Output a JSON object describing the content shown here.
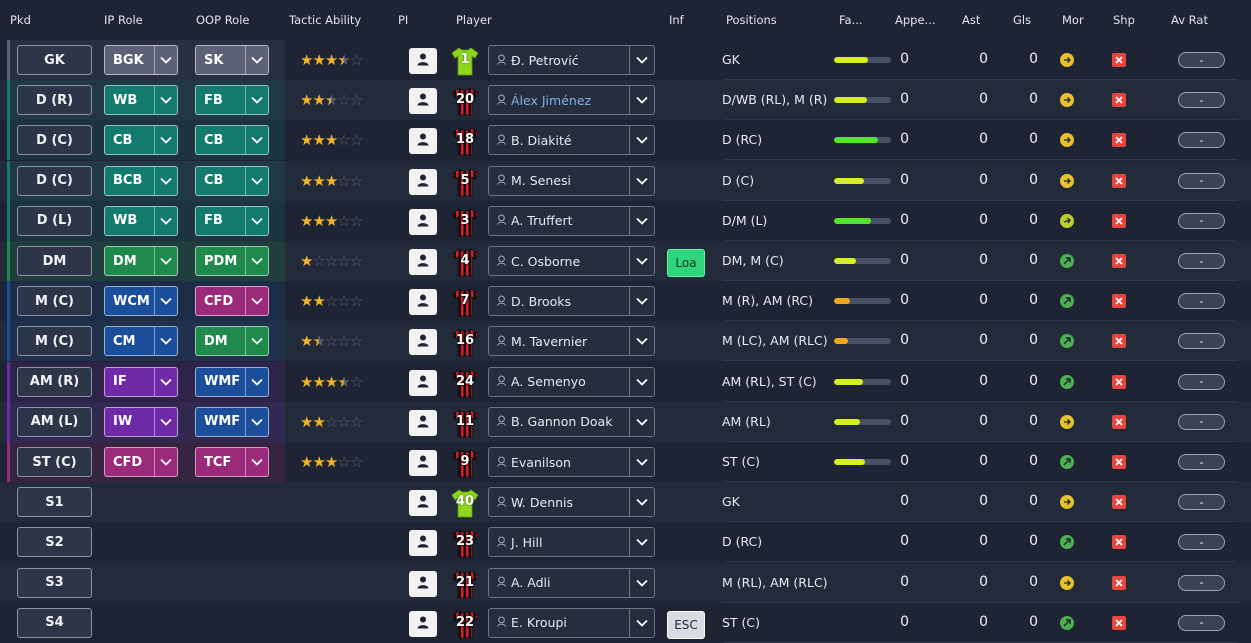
{
  "columns": {
    "pkd": "Pkd",
    "ip_role": "IP Role",
    "oop_role": "OOP Role",
    "tactic_ability": "Tactic Ability",
    "pi": "PI",
    "player": "Player",
    "inf": "Inf",
    "positions": "Positions",
    "fa": "Fa...",
    "appe": "Appe...",
    "ast": "Ast",
    "gls": "Gls",
    "mor": "Mor",
    "shp": "Shp",
    "av_rat": "Av Rat"
  },
  "colors": {
    "gk": "#5c6178",
    "defence": "#137a6e",
    "midfield_dm": "#1f8a4c",
    "midfield": "#1b4f9c",
    "attack": "#6f2aa8",
    "forward": "#9c2a7a",
    "fit_green": "#52e62a",
    "fit_yellow": "#d7ef1e",
    "fit_orange": "#f2a71a",
    "shp_red": "#e8453c"
  },
  "rows": [
    {
      "pkd": "GK",
      "ip": "BGK",
      "ip_c": "gk",
      "oop": "SK",
      "oop_c": "gk",
      "stars": 3.5,
      "shirt": "1",
      "gk": true,
      "name": "Đ. Petrović",
      "link": false,
      "inf": "",
      "pos": "GK",
      "fit": 0.6,
      "fitc": "fit_yellow",
      "appe": "0",
      "ast": "0",
      "gls": "0",
      "mor": "y",
      "avr": "-"
    },
    {
      "pkd": "D (R)",
      "ip": "WB",
      "ip_c": "defence",
      "oop": "FB",
      "oop_c": "defence",
      "stars": 2.5,
      "shirt": "20",
      "gk": false,
      "name": "Álex Jiménez",
      "link": true,
      "inf": "",
      "pos": "D/WB (RL), M (R)",
      "fit": 0.58,
      "fitc": "fit_yellow",
      "appe": "0",
      "ast": "0",
      "gls": "0",
      "mor": "y",
      "avr": "-"
    },
    {
      "pkd": "D (C)",
      "ip": "CB",
      "ip_c": "defence",
      "oop": "CB",
      "oop_c": "defence",
      "stars": 3,
      "shirt": "18",
      "gk": false,
      "name": "B. Diakité",
      "link": false,
      "inf": "",
      "pos": "D (RC)",
      "fit": 0.77,
      "fitc": "fit_green",
      "appe": "0",
      "ast": "0",
      "gls": "0",
      "mor": "y",
      "avr": "-"
    },
    {
      "pkd": "D (C)",
      "ip": "BCB",
      "ip_c": "defence",
      "oop": "CB",
      "oop_c": "defence",
      "stars": 3,
      "shirt": "5",
      "gk": false,
      "name": "M. Senesi",
      "link": false,
      "inf": "",
      "pos": "D (C)",
      "fit": 0.53,
      "fitc": "fit_yellow",
      "appe": "0",
      "ast": "0",
      "gls": "0",
      "mor": "y",
      "avr": "-"
    },
    {
      "pkd": "D (L)",
      "ip": "WB",
      "ip_c": "defence",
      "oop": "FB",
      "oop_c": "defence",
      "stars": 3,
      "shirt": "3",
      "gk": false,
      "name": "A. Truffert",
      "link": false,
      "inf": "",
      "pos": "D/M (L)",
      "fit": 0.65,
      "fitc": "fit_green",
      "appe": "0",
      "ast": "0",
      "gls": "0",
      "mor": "yg",
      "avr": "-"
    },
    {
      "pkd": "DM",
      "ip": "DM",
      "ip_c": "midfield_dm",
      "oop": "PDM",
      "oop_c": "midfield_dm",
      "stars": 1,
      "shirt": "4",
      "gk": false,
      "name": "C. Osborne",
      "link": false,
      "inf": "Loa",
      "inf_c": "loa",
      "pos": "DM, M (C)",
      "fit": 0.38,
      "fitc": "fit_yellow",
      "appe": "0",
      "ast": "0",
      "gls": "0",
      "mor": "g",
      "avr": "-"
    },
    {
      "pkd": "M (C)",
      "ip": "WCM",
      "ip_c": "midfield",
      "oop": "CFD",
      "oop_c": "forward",
      "stars": 2,
      "shirt": "7",
      "gk": false,
      "name": "D. Brooks",
      "link": false,
      "inf": "",
      "pos": "M (R), AM (RC)",
      "fit": 0.28,
      "fitc": "fit_orange",
      "appe": "0",
      "ast": "0",
      "gls": "0",
      "mor": "g",
      "avr": "-"
    },
    {
      "pkd": "M (C)",
      "ip": "CM",
      "ip_c": "midfield",
      "oop": "DM",
      "oop_c": "midfield_dm",
      "stars": 1.5,
      "shirt": "16",
      "gk": false,
      "name": "M. Tavernier",
      "link": false,
      "inf": "",
      "pos": "M (LC), AM (RLC)",
      "fit": 0.24,
      "fitc": "fit_orange",
      "appe": "0",
      "ast": "0",
      "gls": "0",
      "mor": "g",
      "avr": "-"
    },
    {
      "pkd": "AM (R)",
      "ip": "IF",
      "ip_c": "attack",
      "oop": "WMF",
      "oop_c": "midfield",
      "stars": 3.5,
      "shirt": "24",
      "gk": false,
      "name": "A. Semenyo",
      "link": false,
      "inf": "",
      "pos": "AM (RL), ST (C)",
      "fit": 0.5,
      "fitc": "fit_yellow",
      "appe": "0",
      "ast": "0",
      "gls": "0",
      "mor": "g",
      "avr": "-"
    },
    {
      "pkd": "AM (L)",
      "ip": "IW",
      "ip_c": "attack",
      "oop": "WMF",
      "oop_c": "midfield",
      "stars": 2,
      "shirt": "11",
      "gk": false,
      "name": "B. Gannon Doak",
      "link": false,
      "inf": "",
      "pos": "AM (RL)",
      "fit": 0.46,
      "fitc": "fit_yellow",
      "appe": "0",
      "ast": "0",
      "gls": "0",
      "mor": "y",
      "avr": "-"
    },
    {
      "pkd": "ST (C)",
      "ip": "CFD",
      "ip_c": "forward",
      "oop": "TCF",
      "oop_c": "forward",
      "stars": 3,
      "shirt": "9",
      "gk": false,
      "name": "Evanilson",
      "link": false,
      "inf": "",
      "pos": "ST (C)",
      "fit": 0.55,
      "fitc": "fit_yellow",
      "appe": "0",
      "ast": "0",
      "gls": "0",
      "mor": "g",
      "avr": "-"
    },
    {
      "pkd": "S1",
      "ip": "",
      "oop": "",
      "stars": 0,
      "shirt": "40",
      "gk": true,
      "name": "W. Dennis",
      "link": false,
      "inf": "",
      "pos": "GK",
      "fit": 0,
      "fitc": "",
      "appe": "0",
      "ast": "0",
      "gls": "0",
      "mor": "y",
      "avr": "-"
    },
    {
      "pkd": "S2",
      "ip": "",
      "oop": "",
      "stars": 0,
      "shirt": "23",
      "gk": false,
      "name": "J. Hill",
      "link": false,
      "inf": "",
      "pos": "D (RC)",
      "fit": 0,
      "fitc": "",
      "appe": "0",
      "ast": "0",
      "gls": "0",
      "mor": "g",
      "avr": "-"
    },
    {
      "pkd": "S3",
      "ip": "",
      "oop": "",
      "stars": 0,
      "shirt": "21",
      "gk": false,
      "name": "A. Adli",
      "link": false,
      "inf": "",
      "pos": "M (RL), AM (RLC)",
      "fit": 0,
      "fitc": "",
      "appe": "0",
      "ast": "0",
      "gls": "0",
      "mor": "y",
      "avr": "-"
    },
    {
      "pkd": "S4",
      "ip": "",
      "oop": "",
      "stars": 0,
      "shirt": "22",
      "gk": false,
      "name": "E. Kroupi",
      "link": false,
      "inf": "ESC",
      "inf_c": "esc",
      "pos": "ST (C)",
      "fit": 0,
      "fitc": "",
      "appe": "0",
      "ast": "0",
      "gls": "0",
      "mor": "g",
      "avr": "-"
    }
  ]
}
